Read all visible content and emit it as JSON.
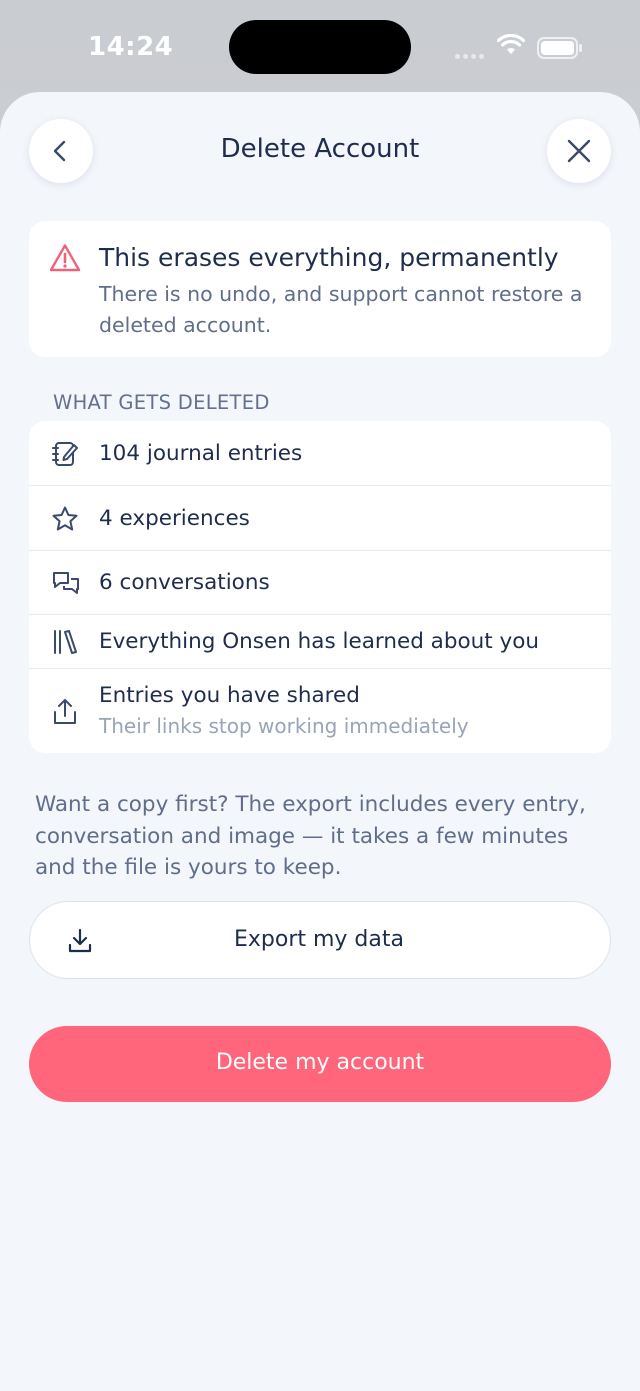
{
  "status_bar": {
    "time": "14:24"
  },
  "header": {
    "title": "Delete Account",
    "back_icon": "chevron-left-icon",
    "close_icon": "close-icon"
  },
  "warning": {
    "icon": "warning-triangle-icon",
    "title": "This erases everything, permanently",
    "body_line1": "There is no undo, and support cannot restore a",
    "body_line2": "deleted account.",
    "color": "#f0617a"
  },
  "deleted_section": {
    "label": "WHAT GETS DELETED",
    "items": [
      {
        "icon": "journal-icon",
        "label": "104 journal entries"
      },
      {
        "icon": "star-icon",
        "label": "4 experiences"
      },
      {
        "icon": "chat-bubbles-icon",
        "label": "6 conversations"
      },
      {
        "icon": "library-icon",
        "label": "Everything Onsen has learned about you"
      },
      {
        "icon": "share-icon",
        "label": "Entries you have shared",
        "sublabel": "Their links stop working immediately"
      }
    ]
  },
  "export": {
    "note_line1": "Want a copy first? The export includes every entry,",
    "note_line2": "conversation and image — it takes a few minutes",
    "note_line3": "and the file is yours to keep.",
    "button_label": "Export my data",
    "icon": "download-icon"
  },
  "delete": {
    "button_label": "Delete my account",
    "color": "#ff657b"
  }
}
